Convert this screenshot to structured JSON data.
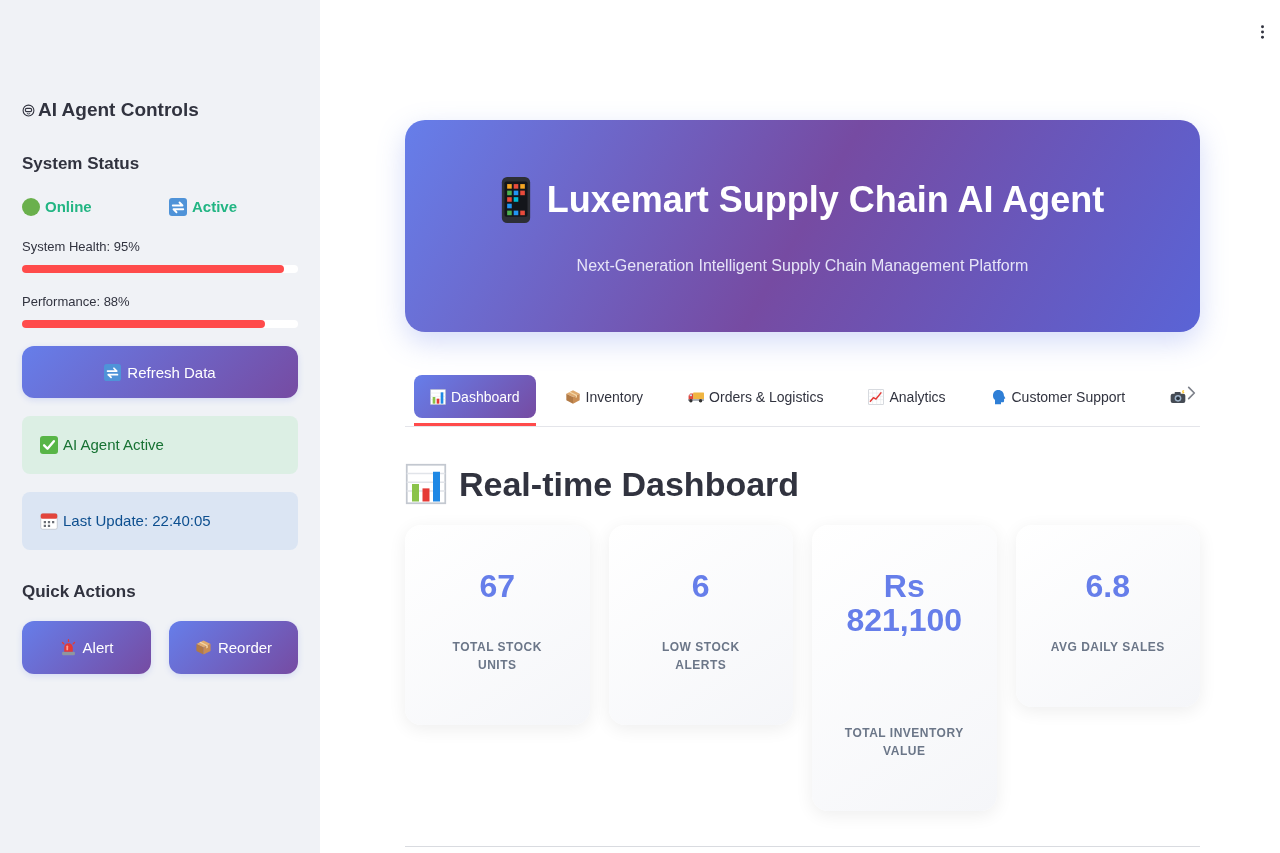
{
  "sidebar": {
    "title": "AI Agent Controls",
    "status_heading": "System Status",
    "statuses": [
      "Online",
      "Active"
    ],
    "meters": [
      {
        "label": "System Health: 95%",
        "level": 0.95
      },
      {
        "label": "Performance: 88%",
        "level": 0.88
      }
    ],
    "refresh_button": "Refresh Data",
    "notices": [
      {
        "kind": "success",
        "text": "AI Agent Active"
      },
      {
        "kind": "info",
        "text": "Last Update: 22:40:05"
      }
    ],
    "quick_actions_heading": "Quick Actions",
    "quick_actions": [
      "Alert",
      "Reorder"
    ]
  },
  "hero": {
    "title": "Luxemart Supply Chain AI Agent",
    "subtitle": "Next-Generation Intelligent Supply Chain Management Platform"
  },
  "tabs": [
    {
      "label": "Dashboard",
      "selected": true
    },
    {
      "label": "Inventory",
      "selected": false
    },
    {
      "label": "Orders & Logistics",
      "selected": false
    },
    {
      "label": "Analytics",
      "selected": false
    },
    {
      "label": "Customer Support",
      "selected": false
    },
    {
      "selected": false
    }
  ],
  "dashboard": {
    "heading": "Real-time Dashboard",
    "metrics": [
      {
        "value": "67",
        "label": "TOTAL STOCK UNITS"
      },
      {
        "value": "6",
        "label": "LOW STOCK ALERTS"
      },
      {
        "value": "Rs 821,100",
        "label": "TOTAL INVENTORY VALUE"
      },
      {
        "value": "6.8",
        "label": "AVG DAILY SALES"
      }
    ]
  }
}
